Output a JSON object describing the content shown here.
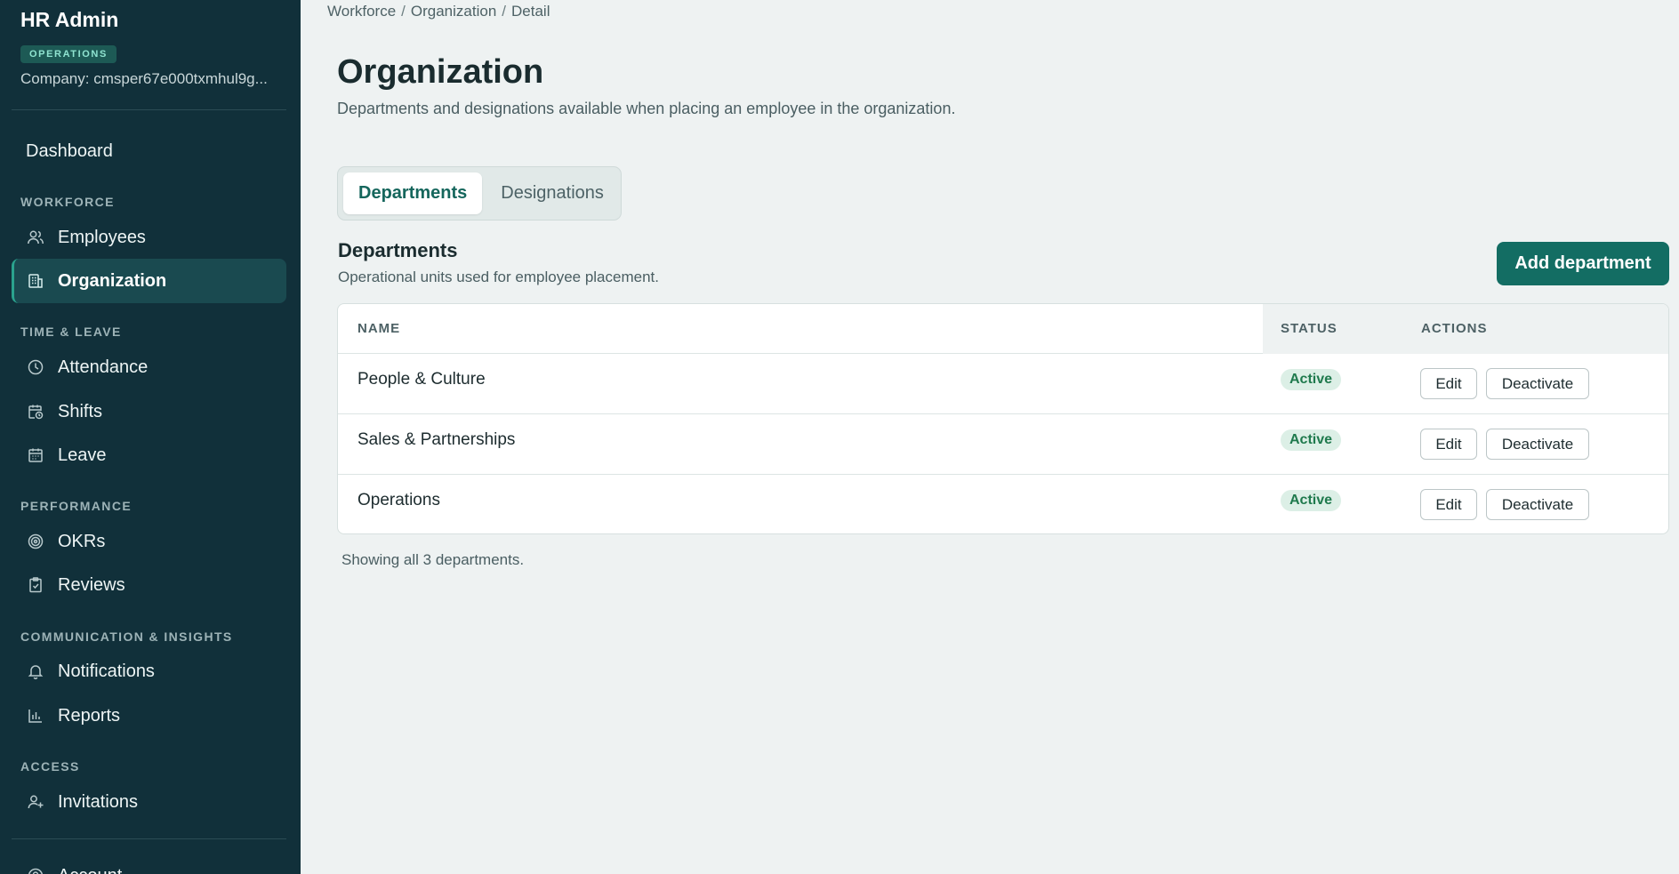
{
  "brand": {
    "title": "HR Admin",
    "badge": "OPERATIONS",
    "company": "Company: cmsper67e000txmhul9g..."
  },
  "nav": {
    "dashboard": "Dashboard",
    "sections": {
      "workforce": "WORKFORCE",
      "time_leave": "TIME & LEAVE",
      "performance": "PERFORMANCE",
      "comm": "COMMUNICATION & INSIGHTS",
      "access": "ACCESS"
    },
    "items": {
      "employees": "Employees",
      "organization": "Organization",
      "attendance": "Attendance",
      "shifts": "Shifts",
      "leave": "Leave",
      "okrs": "OKRs",
      "reviews": "Reviews",
      "notifications": "Notifications",
      "reports": "Reports",
      "invitations": "Invitations",
      "account": "Account"
    },
    "active": "organization"
  },
  "breadcrumb": [
    "Workforce",
    "Organization",
    "Detail"
  ],
  "breadcrumb_sep": "/",
  "page": {
    "title": "Organization",
    "subtitle": "Departments and designations available when placing an employee in the organization."
  },
  "tabs": [
    {
      "label": "Departments",
      "active": true
    },
    {
      "label": "Designations",
      "active": false
    }
  ],
  "section": {
    "title": "Departments",
    "subtitle": "Operational units used for employee placement.",
    "add_button": "Add department"
  },
  "table": {
    "headers": {
      "name": "NAME",
      "status": "STATUS",
      "actions": "ACTIONS"
    },
    "rows": [
      {
        "name": "People & Culture",
        "status": "Active",
        "edit": "Edit",
        "deactivate": "Deactivate"
      },
      {
        "name": "Sales & Partnerships",
        "status": "Active",
        "edit": "Edit",
        "deactivate": "Deactivate"
      },
      {
        "name": "Operations",
        "status": "Active",
        "edit": "Edit",
        "deactivate": "Deactivate"
      }
    ]
  },
  "footer_note": "Showing all 3 departments.",
  "colors": {
    "sidebar_bg": "#11303a",
    "accent": "#136d63",
    "active_badge_bg": "#dcefe6",
    "active_badge_text": "#1f7a4d"
  }
}
